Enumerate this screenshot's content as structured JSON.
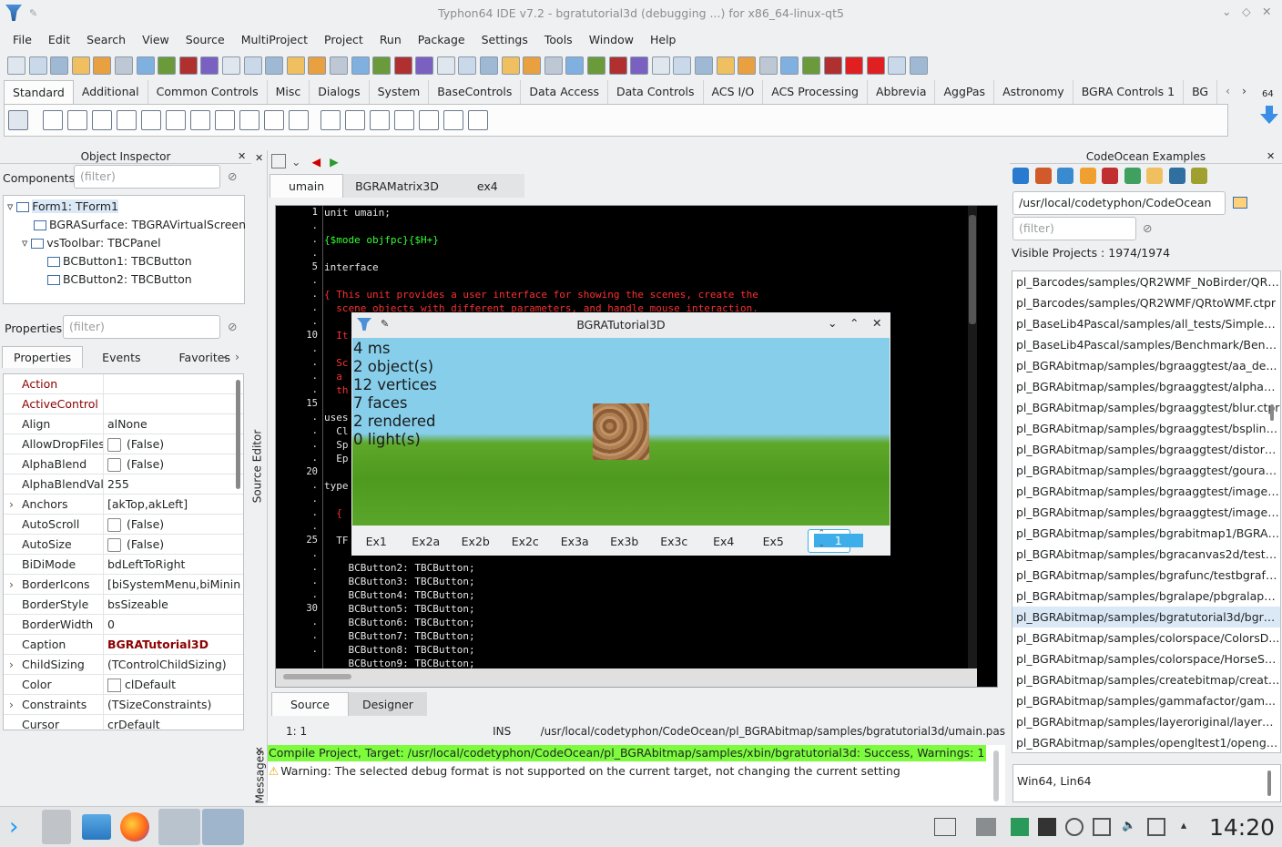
{
  "window": {
    "title": "Typhon64 IDE v7.2 - bgratutorial3d (debugging ...) for x86_64-linux-qt5"
  },
  "menu": [
    "File",
    "Edit",
    "Search",
    "View",
    "Source",
    "MultiProject",
    "Project",
    "Run",
    "Package",
    "Settings",
    "Tools",
    "Window",
    "Help"
  ],
  "palette_tabs": [
    "Standard",
    "Additional",
    "Common Controls",
    "Misc",
    "Dialogs",
    "System",
    "BaseControls",
    "Data Access",
    "Data Controls",
    "ACS I/O",
    "ACS Processing",
    "Abbrevia",
    "AggPas",
    "Astronomy",
    "BGRA Controls 1",
    "BG"
  ],
  "palette_side": {
    "count": "64"
  },
  "object_inspector": {
    "title": "Object Inspector",
    "components_label": "Components",
    "filter_placeholder": "(filter)",
    "tree": [
      "Form1: TForm1",
      "BGRASurface: TBGRAVirtualScreen",
      "vsToolbar: TBCPanel",
      "BCButton1: TBCButton",
      "BCButton2: TBCButton"
    ],
    "properties_label": "Properties",
    "tabs": [
      "Properties",
      "Events",
      "Favorites"
    ],
    "props": [
      {
        "name": "Action",
        "value": "",
        "red": true
      },
      {
        "name": "ActiveControl",
        "value": "",
        "red": true
      },
      {
        "name": "Align",
        "value": "alNone"
      },
      {
        "name": "AllowDropFiles",
        "value": "(False)",
        "check": true
      },
      {
        "name": "AlphaBlend",
        "value": "(False)",
        "check": true
      },
      {
        "name": "AlphaBlendValu",
        "value": "255"
      },
      {
        "name": "Anchors",
        "value": "[akTop,akLeft]",
        "exp": true
      },
      {
        "name": "AutoScroll",
        "value": "(False)",
        "check": true
      },
      {
        "name": "AutoSize",
        "value": "(False)",
        "check": true
      },
      {
        "name": "BiDiMode",
        "value": "bdLeftToRight"
      },
      {
        "name": "BorderIcons",
        "value": "[biSystemMenu,biMinin",
        "exp": true
      },
      {
        "name": "BorderStyle",
        "value": "bsSizeable"
      },
      {
        "name": "BorderWidth",
        "value": "0"
      },
      {
        "name": "Caption",
        "value": "BGRATutorial3D",
        "bold": true
      },
      {
        "name": "ChildSizing",
        "value": "(TControlChildSizing)",
        "exp": true
      },
      {
        "name": "Color",
        "value": "clDefault",
        "swatch": true
      },
      {
        "name": "Constraints",
        "value": "(TSizeConstraints)",
        "exp": true
      },
      {
        "name": "Cursor",
        "value": "crDefault"
      }
    ]
  },
  "editor": {
    "side_label": "Source Editor",
    "tabs": [
      "umain",
      "BGRAMatrix3D",
      "ex4"
    ],
    "gutter": [
      "1",
      ".",
      ".",
      ".",
      "5",
      ".",
      ".",
      ".",
      ".",
      "10",
      ".",
      ".",
      ".",
      ".",
      "15",
      ".",
      ".",
      ".",
      ".",
      "20",
      ".",
      ".",
      ".",
      ".",
      "25",
      ".",
      ".",
      ".",
      ".",
      "30",
      ".",
      ".",
      "."
    ],
    "lines": [
      {
        "t": "unit umain;",
        "c": "kw"
      },
      {
        "t": "",
        "c": "kw"
      },
      {
        "t": "{$mode objfpc}{$H+}",
        "c": "dr"
      },
      {
        "t": "",
        "c": "kw"
      },
      {
        "t": "interface",
        "c": "kw"
      },
      {
        "t": "",
        "c": "kw"
      },
      {
        "t": "{ This unit provides a user interface for showing the scenes, create the",
        "c": "cm"
      },
      {
        "t": "  scene objects with different parameters, and handle mouse interaction.",
        "c": "cm"
      },
      {
        "t": "",
        "c": "kw"
      },
      {
        "t": "  It",
        "c": "cm"
      },
      {
        "t": "",
        "c": "kw"
      },
      {
        "t": "  Sc",
        "c": "cm"
      },
      {
        "t": "  a ",
        "c": "cm"
      },
      {
        "t": "  th",
        "c": "cm"
      },
      {
        "t": "",
        "c": "kw"
      },
      {
        "t": "uses",
        "c": "kw"
      },
      {
        "t": "  Cl",
        "c": "kw"
      },
      {
        "t": "  Sp",
        "c": "kw"
      },
      {
        "t": "  Ep",
        "c": "kw"
      },
      {
        "t": "",
        "c": "kw"
      },
      {
        "t": "type",
        "c": "kw"
      },
      {
        "t": "",
        "c": "kw"
      },
      {
        "t": "  {",
        "c": "cm"
      },
      {
        "t": "",
        "c": "kw"
      },
      {
        "t": "  TF",
        "c": "kw"
      },
      {
        "t": "",
        "c": "kw"
      },
      {
        "t": "    BCButton2: TBCButton;",
        "c": "kw"
      },
      {
        "t": "    BCButton3: TBCButton;",
        "c": "kw"
      },
      {
        "t": "    BCButton4: TBCButton;",
        "c": "kw"
      },
      {
        "t": "    BCButton5: TBCButton;",
        "c": "kw"
      },
      {
        "t": "    BCButton6: TBCButton;",
        "c": "kw"
      },
      {
        "t": "    BCButton7: TBCButton;",
        "c": "kw"
      },
      {
        "t": "    BCButton8: TBCButton;",
        "c": "kw"
      },
      {
        "t": "    BCButton9: TBCButton;",
        "c": "kw"
      }
    ],
    "bottom_tabs": [
      "Source",
      "Designer"
    ],
    "status": {
      "pos": "1:  1",
      "mode": "INS",
      "file": "/usr/local/codetyphon/CodeOcean/pl_BGRAbitmap/samples/bgratutorial3d/umain.pas"
    }
  },
  "bgra_window": {
    "title": "BGRATutorial3D",
    "stats": [
      "4 ms",
      "2 object(s)",
      "12 vertices",
      "7 faces",
      "2 rendered",
      "0 light(s)"
    ],
    "buttons": [
      "Ex1",
      "Ex2a",
      "Ex2b",
      "Ex2c",
      "Ex3a",
      "Ex3b",
      "Ex3c",
      "Ex4",
      "Ex5"
    ],
    "spin_value": "1"
  },
  "messages": {
    "side_label": "Messages",
    "success": "Compile Project, Target: /usr/local/codetyphon/CodeOcean/pl_BGRAbitmap/samples/xbin/bgratutorial3d: Success, Warnings: 1",
    "warning": "Warning: The selected debug format is not supported on the current target, not changing the current setting"
  },
  "codeocean": {
    "title": "CodeOcean Examples",
    "path": "/usr/local/codetyphon/CodeOcean",
    "filter_placeholder": "(filter)",
    "visible": "Visible Projects : 1974/1974",
    "projects": [
      "pl_Barcodes/samples/QR2WMF_NoBirder/QRt...",
      "pl_Barcodes/samples/QR2WMF/QRtoWMF.ctpr",
      "pl_BaseLib4Pascal/samples/all_tests/SimpleB...",
      "pl_BaseLib4Pascal/samples/Benchmark/Benc...",
      "pl_BGRAbitmap/samples/bgraaggtest/aa_de...",
      "pl_BGRAbitmap/samples/bgraaggtest/alpha_...",
      "pl_BGRAbitmap/samples/bgraaggtest/blur.ctpr",
      "pl_BGRAbitmap/samples/bgraaggtest/bspline...",
      "pl_BGRAbitmap/samples/bgraaggtest/distorti...",
      "pl_BGRAbitmap/samples/bgraaggtest/gourau...",
      "pl_BGRAbitmap/samples/bgraaggtest/image_...",
      "pl_BGRAbitmap/samples/bgraaggtest/image_...",
      "pl_BGRAbitmap/samples/bgrabitmap1/BGRA_...",
      "pl_BGRAbitmap/samples/bgracanvas2d/testc...",
      "pl_BGRAbitmap/samples/bgrafunc/testbgrafu...",
      "pl_BGRAbitmap/samples/bgralape/pbgralape....",
      "pl_BGRAbitmap/samples/bgratutorial3d/bgra...",
      "pl_BGRAbitmap/samples/colorspace/ColorsD...",
      "pl_BGRAbitmap/samples/colorspace/HorseSh...",
      "pl_BGRAbitmap/samples/createbitmap/create...",
      "pl_BGRAbitmap/samples/gammafactor/gam...",
      "pl_BGRAbitmap/samples/layeroriginal/layeror...",
      "pl_BGRAbitmap/samples/opengltest1/openglt..."
    ],
    "selected_index": 16,
    "platform": "Win64, Lin64"
  },
  "taskbar": {
    "clock": "14:20"
  }
}
